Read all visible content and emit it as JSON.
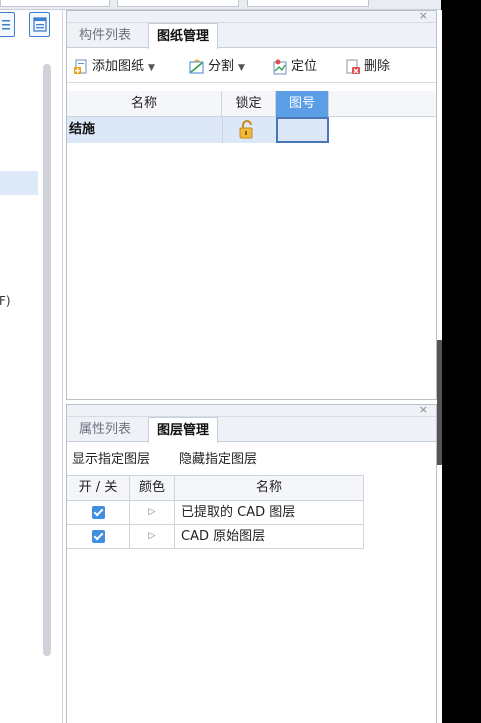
{
  "left_panel": {
    "fragment": "F)"
  },
  "drawing_panel": {
    "close": "×",
    "tabs": [
      {
        "label": "构件列表",
        "active": false
      },
      {
        "label": "图纸管理",
        "active": true
      }
    ],
    "toolbar": {
      "add": "添加图纸",
      "split": "分割",
      "locate": "定位",
      "delete": "删除"
    },
    "columns": [
      "名称",
      "锁定",
      "图号"
    ],
    "rows": [
      {
        "name": "结施",
        "locked": false,
        "number": ""
      }
    ]
  },
  "layer_panel": {
    "close": "×",
    "tabs": [
      {
        "label": "属性列表",
        "active": false
      },
      {
        "label": "图层管理",
        "active": true
      }
    ],
    "actions": {
      "show": "显示指定图层",
      "hide": "隐藏指定图层"
    },
    "columns": [
      "开 / 关",
      "颜色",
      "名称"
    ],
    "rows": [
      {
        "on": true,
        "name": "已提取的 CAD 图层"
      },
      {
        "on": true,
        "name": "CAD 原始图层"
      }
    ]
  },
  "colors": {
    "accent": "#5b9ee6",
    "selection": "#dce8f8",
    "checkbox": "#3f8ee0"
  }
}
